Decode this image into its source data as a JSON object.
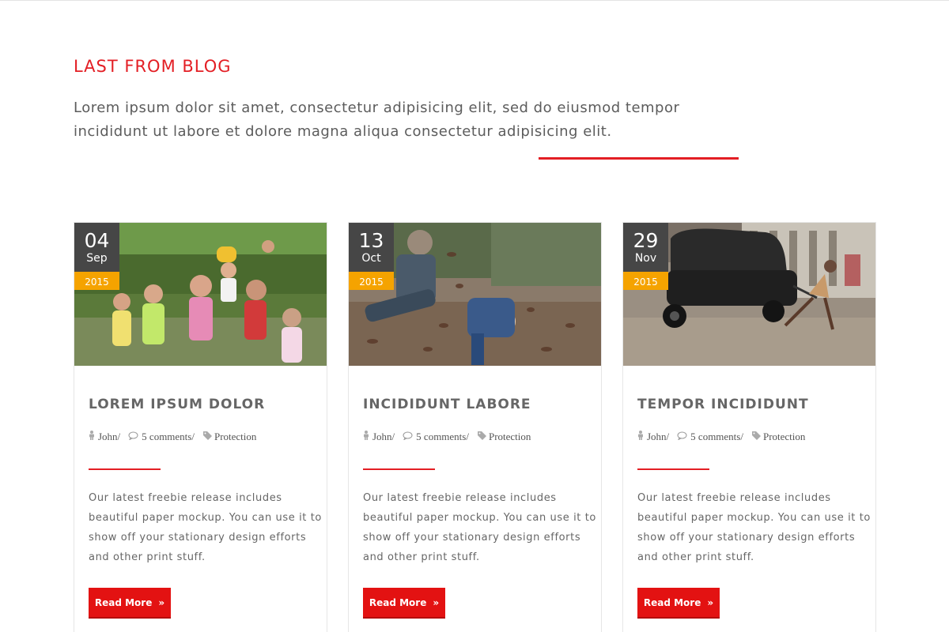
{
  "section": {
    "title": "LAST FROM BLOG",
    "intro": "Lorem ipsum dolor sit amet, consectetur adipisicing elit, sed do eiusmod tempor incididunt ut labore et dolore magna aliqua consectetur adipisicing elit."
  },
  "colors": {
    "accent": "#e31e24",
    "date_bg": "#464646",
    "year_bg": "#f5a300"
  },
  "posts": [
    {
      "day": "04",
      "month": "Sep",
      "year": "2015",
      "title": "LOREM IPSUM DOLOR",
      "author": "John/",
      "comments": "5 comments/",
      "category": "Protection",
      "excerpt": "Our latest freebie release includes beautiful paper mockup. You can use it to show off your stationary design efforts and other print stuff.",
      "button": "Read More",
      "image": "children-group-photo"
    },
    {
      "day": "13",
      "month": "Oct",
      "year": "2015",
      "title": "INCIDIDUNT LABORE",
      "author": "John/",
      "comments": "5 comments/",
      "category": "Protection",
      "excerpt": "Our latest freebie release includes beautiful paper mockup. You can use it to show off your stationary design efforts and other print stuff.",
      "button": "Read More",
      "image": "kids-playing-leaves-photo"
    },
    {
      "day": "29",
      "month": "Nov",
      "year": "2015",
      "title": "TEMPOR INCIDIDUNT",
      "author": "John/",
      "comments": "5 comments/",
      "category": "Protection",
      "excerpt": "Our latest freebie release includes beautiful paper mockup. You can use it to show off your stationary design efforts and other print stuff.",
      "button": "Read More",
      "image": "boy-pulling-car-photo"
    }
  ],
  "icons": {
    "author": "user-icon",
    "comments": "comment-icon",
    "category": "tag-icon",
    "button": "double-chevron-right-icon"
  }
}
